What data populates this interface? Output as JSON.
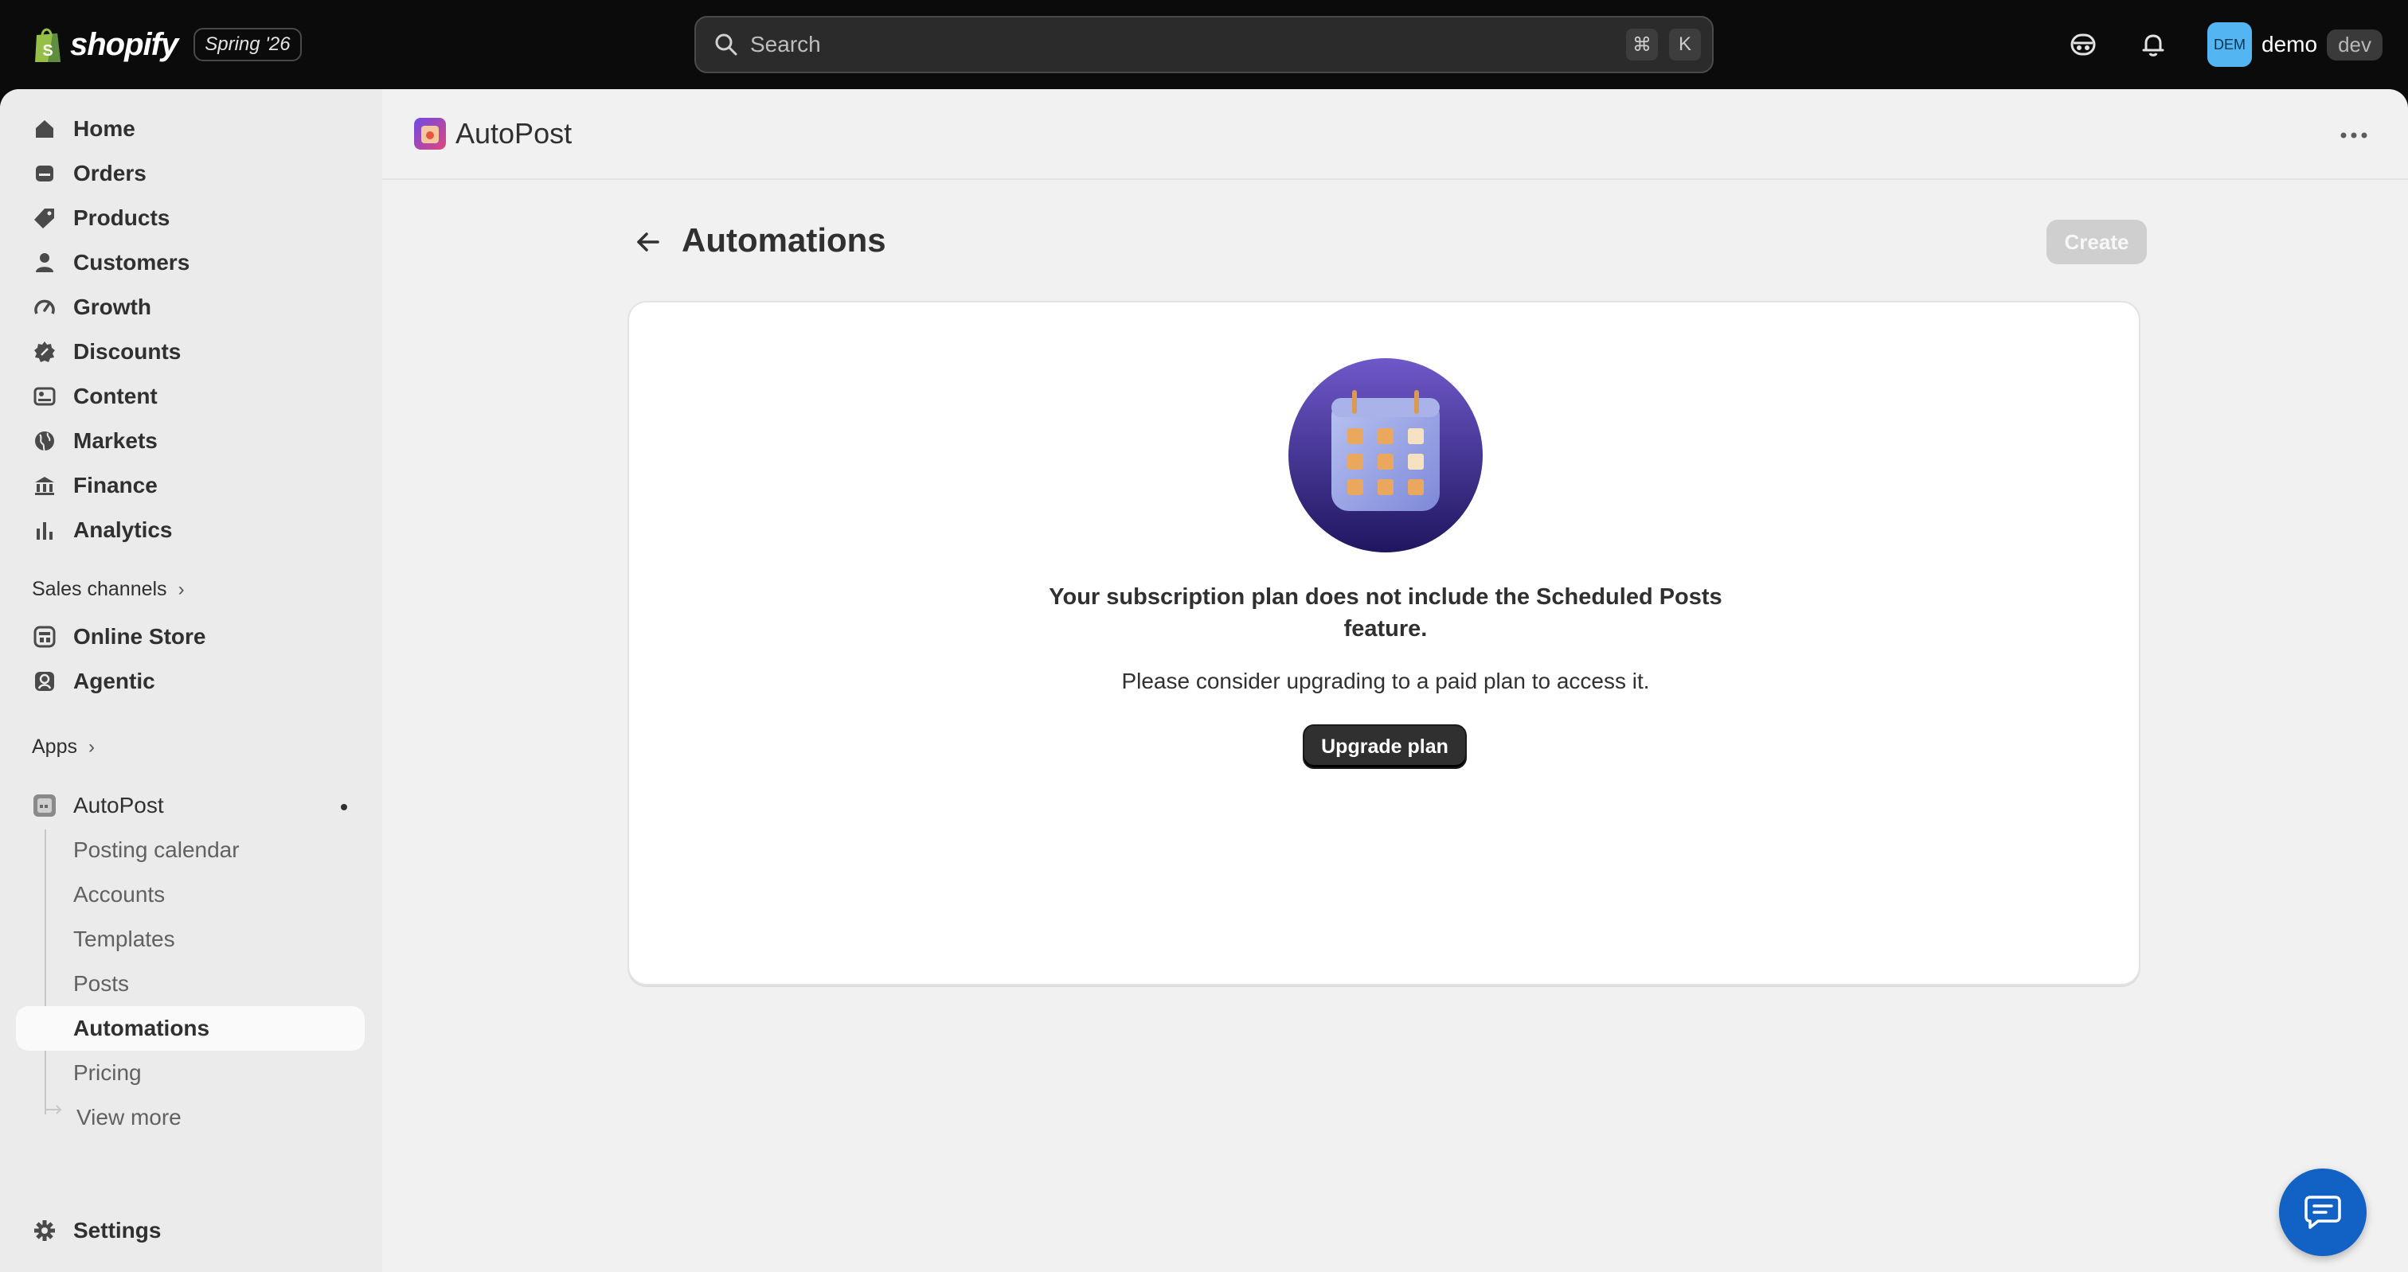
{
  "topbar": {
    "brand": "shopify",
    "edition": "Spring '26",
    "search_placeholder": "Search",
    "shortcut_cmd": "⌘",
    "shortcut_key": "K",
    "avatar_initials": "DEM",
    "user_name": "demo",
    "env_badge": "dev"
  },
  "sidebar": {
    "nav": [
      {
        "label": "Home",
        "icon": "home-icon"
      },
      {
        "label": "Orders",
        "icon": "orders-icon"
      },
      {
        "label": "Products",
        "icon": "tag-icon"
      },
      {
        "label": "Customers",
        "icon": "person-icon"
      },
      {
        "label": "Growth",
        "icon": "gauge-icon"
      },
      {
        "label": "Discounts",
        "icon": "discount-icon"
      },
      {
        "label": "Content",
        "icon": "content-icon"
      },
      {
        "label": "Markets",
        "icon": "globe-icon"
      },
      {
        "label": "Finance",
        "icon": "bank-icon"
      },
      {
        "label": "Analytics",
        "icon": "bar-chart-icon"
      }
    ],
    "sales_channels_label": "Sales channels",
    "channels": [
      {
        "label": "Online Store",
        "icon": "store-icon"
      },
      {
        "label": "Agentic",
        "icon": "agentic-icon"
      }
    ],
    "apps_label": "Apps",
    "app": {
      "label": "AutoPost",
      "subitems": [
        "Posting calendar",
        "Accounts",
        "Templates",
        "Posts",
        "Automations",
        "Pricing"
      ],
      "active": "Automations",
      "view_more": "View more"
    },
    "settings_label": "Settings"
  },
  "app_header": {
    "title": "AutoPost"
  },
  "page": {
    "title": "Automations",
    "create_label": "Create"
  },
  "card": {
    "heading": "Your subscription plan does not include the Scheduled Posts feature.",
    "body": "Please consider upgrading to a paid plan to access it.",
    "button": "Upgrade plan"
  },
  "colors": {
    "topbar_bg": "#0b0b0b",
    "accent_blue": "#1261c4",
    "avatar_bg": "#53b6f2",
    "primary_button": "#303030"
  }
}
